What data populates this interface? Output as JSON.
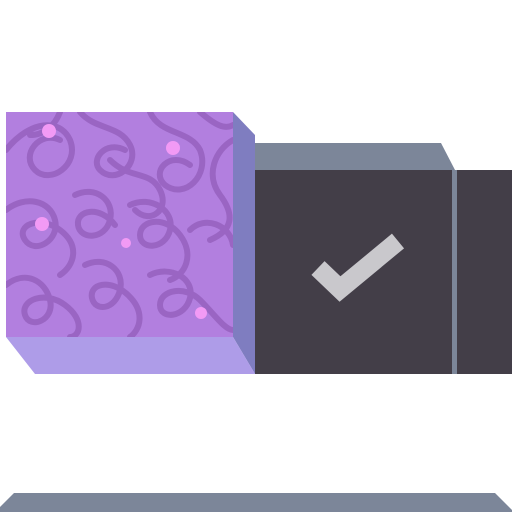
{
  "illustration": {
    "icon": "checkbox-toggle-icon",
    "state": "checked",
    "colors": {
      "background": "#ffffff",
      "cube_front": "#b27fdf",
      "cube_right_side": "#7f7dc0",
      "cube_bottom": "#ae9ce8",
      "squiggle_pattern": "#9863c0",
      "sparkle_dots": "#f29af5",
      "dark_panel": "#433e48",
      "panel_top_face": "#7c8699",
      "divider": "#7c8699",
      "checkmark": "#c9c8cc",
      "floor_bar": "#7c8699"
    }
  }
}
